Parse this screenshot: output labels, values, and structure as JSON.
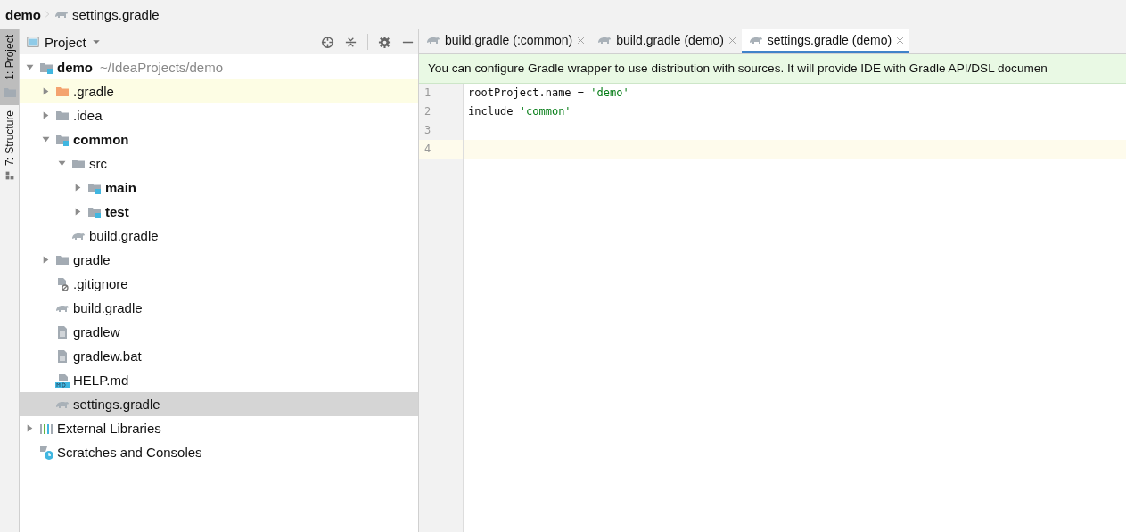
{
  "breadcrumb": [
    {
      "label": "demo",
      "kind": "project"
    },
    {
      "label": "settings.gradle",
      "kind": "gradle"
    }
  ],
  "side_tabs": [
    {
      "label": "1: Project",
      "kind": "folder",
      "selected": true
    },
    {
      "label": "7: Structure",
      "kind": "structure",
      "selected": false
    }
  ],
  "project_panel": {
    "title": "Project",
    "tree": [
      {
        "label": "demo",
        "detail": "~/IdeaProjects/demo",
        "kind": "module",
        "bold": true,
        "expanded": true,
        "selected": false,
        "highlighted": false,
        "children": [
          {
            "label": ".gradle",
            "kind": "excluded-folder",
            "bold": false,
            "expanded": false,
            "selected": false,
            "highlighted": true
          },
          {
            "label": ".idea",
            "kind": "folder",
            "bold": false,
            "expanded": false,
            "selected": false,
            "highlighted": false
          },
          {
            "label": "common",
            "kind": "module",
            "bold": true,
            "expanded": true,
            "selected": false,
            "highlighted": false,
            "children": [
              {
                "label": "src",
                "kind": "folder",
                "bold": false,
                "expanded": true,
                "selected": false,
                "highlighted": false,
                "children": [
                  {
                    "label": "main",
                    "kind": "module",
                    "bold": true,
                    "expanded": false,
                    "selected": false,
                    "highlighted": false
                  },
                  {
                    "label": "test",
                    "kind": "module",
                    "bold": true,
                    "expanded": false,
                    "selected": false,
                    "highlighted": false
                  }
                ]
              },
              {
                "label": "build.gradle",
                "kind": "gradle",
                "bold": false,
                "selected": false,
                "highlighted": false
              }
            ]
          },
          {
            "label": "gradle",
            "kind": "folder",
            "bold": false,
            "expanded": false,
            "selected": false,
            "highlighted": false
          },
          {
            "label": ".gitignore",
            "kind": "ignored-file",
            "bold": false,
            "selected": false,
            "highlighted": false
          },
          {
            "label": "build.gradle",
            "kind": "gradle",
            "bold": false,
            "selected": false,
            "highlighted": false
          },
          {
            "label": "gradlew",
            "kind": "text-file",
            "bold": false,
            "selected": false,
            "highlighted": false
          },
          {
            "label": "gradlew.bat",
            "kind": "text-file",
            "bold": false,
            "selected": false,
            "highlighted": false
          },
          {
            "label": "HELP.md",
            "kind": "markdown",
            "bold": false,
            "selected": false,
            "highlighted": false
          },
          {
            "label": "settings.gradle",
            "kind": "gradle",
            "bold": false,
            "selected": true,
            "highlighted": false
          }
        ]
      },
      {
        "label": "External Libraries",
        "kind": "libraries",
        "bold": false,
        "expanded": false,
        "selected": false,
        "highlighted": false
      },
      {
        "label": "Scratches and Consoles",
        "kind": "scratches",
        "bold": false,
        "selected": false,
        "highlighted": false
      }
    ]
  },
  "editor_tabs": [
    {
      "label": "build.gradle (:common)",
      "selected": false
    },
    {
      "label": "build.gradle (demo)",
      "selected": false
    },
    {
      "label": "settings.gradle (demo)",
      "selected": true
    }
  ],
  "notification": "You can configure Gradle wrapper to use distribution with sources. It will provide IDE with Gradle API/DSL documen",
  "code_lines": [
    {
      "number": "1",
      "current": false,
      "tokens": [
        {
          "text": "rootProject.name = ",
          "kind": "plain"
        },
        {
          "text": "'demo'",
          "kind": "string"
        }
      ]
    },
    {
      "number": "2",
      "current": false,
      "tokens": [
        {
          "text": "include ",
          "kind": "plain"
        },
        {
          "text": "'common'",
          "kind": "string"
        }
      ]
    },
    {
      "number": "3",
      "current": false
    },
    {
      "number": "4",
      "current": true
    }
  ]
}
